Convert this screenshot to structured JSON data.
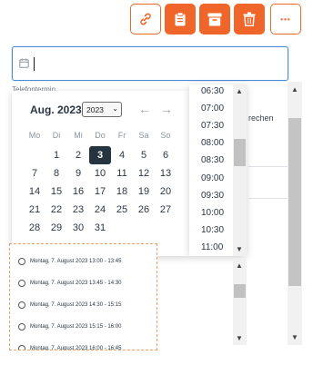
{
  "toolbar": {
    "buttons": [
      {
        "icon": "link-icon",
        "style": "outline"
      },
      {
        "icon": "clipboard-icon",
        "style": "solid"
      },
      {
        "icon": "archive-icon",
        "style": "solid"
      },
      {
        "icon": "trash-icon",
        "style": "solid"
      },
      {
        "icon": "more-icon",
        "style": "outline"
      }
    ],
    "more_label": "•••"
  },
  "date_field": {
    "value": "",
    "icon": "calendar-icon"
  },
  "background": {
    "label": "Telefontermin",
    "partial_text": "rechen"
  },
  "calendar": {
    "month_label": "Aug. 2023",
    "year": "2023",
    "weekdays": [
      "Mo",
      "Di",
      "Mi",
      "Do",
      "Fr",
      "Sa",
      "So"
    ],
    "weeks": [
      [
        "",
        "1",
        "2",
        "3",
        "4",
        "5",
        "6"
      ],
      [
        "7",
        "8",
        "9",
        "10",
        "11",
        "12",
        "13"
      ],
      [
        "14",
        "15",
        "16",
        "17",
        "18",
        "19",
        "20"
      ],
      [
        "21",
        "22",
        "23",
        "24",
        "25",
        "26",
        "27"
      ],
      [
        "28",
        "29",
        "30",
        "31",
        "",
        "",
        ""
      ]
    ],
    "selected_day": "3"
  },
  "times": [
    "06:30",
    "07:00",
    "07:30",
    "08:00",
    "08:30",
    "09:00",
    "09:30",
    "10:00",
    "10:30",
    "11:00"
  ],
  "slots": [
    "Montag, 7. August 2023 13:00 - 13:45",
    "Montag, 7. August 2023 13:45 - 14:30",
    "Montag, 7. August 2023 14:30 - 15:15",
    "Montag, 7. August 2023 15:15 - 16:00",
    "Montag, 7. August 2023 16:00 - 16:45"
  ],
  "colors": {
    "accent": "#f0652a",
    "selected_day_bg": "#26343f",
    "focus": "#4c8bd6"
  }
}
